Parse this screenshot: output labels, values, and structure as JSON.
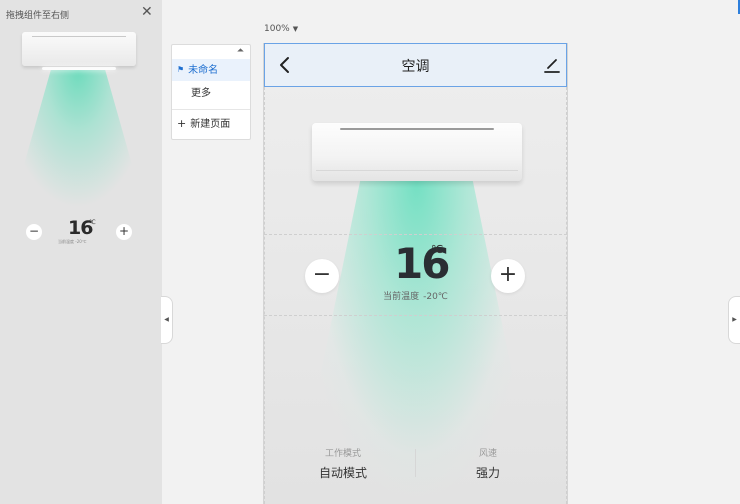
{
  "left_panel": {
    "title": "拖拽组件至右侧",
    "close_glyph": "✕",
    "preview": {
      "temperature": "16",
      "unit": "℃",
      "current_label": "当前温度",
      "current_value": "-20℃",
      "minus_glyph": "−",
      "plus_glyph": "+"
    }
  },
  "pages_menu": {
    "collapse_glyph": "⏶",
    "items": [
      {
        "label": "未命名",
        "icon": "home-icon",
        "active": true
      },
      {
        "label": "更多",
        "active": false
      }
    ],
    "add_label": "新建页面",
    "add_glyph": "+"
  },
  "zoom": {
    "value": "100%",
    "arrow": "▼"
  },
  "header": {
    "title": "空调"
  },
  "control": {
    "temperature": "16",
    "unit": "℃",
    "current_label": "当前温度",
    "current_value": "-20℃",
    "minus_glyph": "−",
    "plus_glyph": "+"
  },
  "modes": {
    "work_label": "工作模式",
    "work_value": "自动模式",
    "wind_label": "风速",
    "wind_value": "强力"
  },
  "toggles": {
    "left_glyph": "◀",
    "right_glyph": "▶"
  },
  "colors": {
    "accent": "#1e6fd0",
    "beam": "#5adab6",
    "header_border": "#6aa3e6"
  }
}
